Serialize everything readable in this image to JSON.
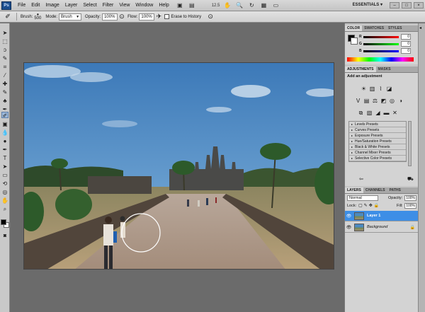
{
  "app": {
    "logo": "Ps",
    "zoom": "12.5",
    "workspace": "ESSENTIALS ▾"
  },
  "menu": [
    "File",
    "Edit",
    "Image",
    "Layer",
    "Select",
    "Filter",
    "View",
    "Window",
    "Help"
  ],
  "options": {
    "brush_label": "Brush:",
    "brush_size": "500",
    "mode_label": "Mode:",
    "mode_value": "Brush",
    "opacity_label": "Opacity:",
    "opacity_value": "100%",
    "flow_label": "Flow:",
    "flow_value": "100%",
    "erase_history_label": "Erase to History"
  },
  "color_panel": {
    "tabs": [
      "COLOR",
      "SWATCHES",
      "STYLES"
    ],
    "channels": [
      {
        "label": "R",
        "value": "0"
      },
      {
        "label": "G",
        "value": "0"
      },
      {
        "label": "B",
        "value": "0"
      }
    ]
  },
  "adjustments_panel": {
    "tabs": [
      "ADJUSTMENTS",
      "MASKS"
    ],
    "title": "Add an adjustment",
    "presets": [
      "Levels Presets",
      "Curves Presets",
      "Exposure Presets",
      "Hue/Saturation Presets",
      "Black & White Presets",
      "Channel Mixer Presets",
      "Selective Color Presets"
    ]
  },
  "layers_panel": {
    "tabs": [
      "LAYERS",
      "CHANNELS",
      "PATHS"
    ],
    "blend_mode": "Normal",
    "opacity_label": "Opacity:",
    "opacity_value": "100%",
    "lock_label": "Lock:",
    "fill_label": "Fill:",
    "fill_value": "100%",
    "layers": [
      {
        "name": "Layer 1",
        "selected": true
      },
      {
        "name": "Background",
        "selected": false
      }
    ]
  },
  "colors": {
    "selection_blue": "#3d8ee6",
    "panel_bg": "#d3d3d3",
    "workspace_bg": "#6b6b6b"
  }
}
